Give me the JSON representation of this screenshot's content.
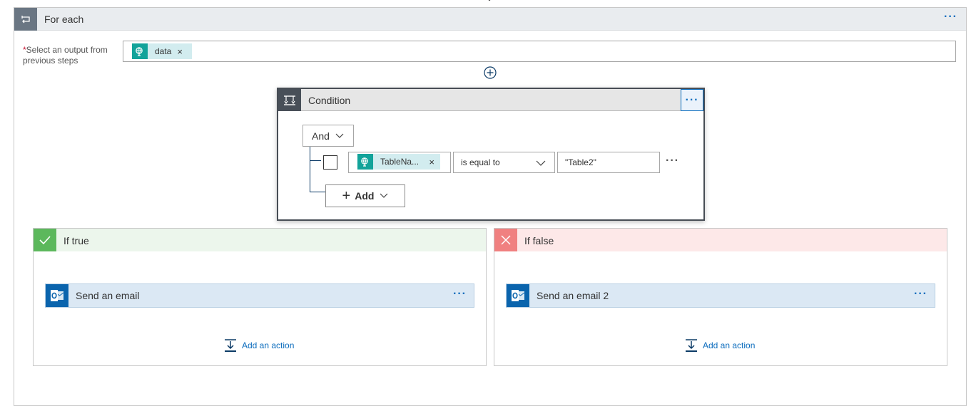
{
  "foreach": {
    "title": "For each",
    "select_label_required_mark": "*",
    "select_label": "Select an output from previous steps",
    "token": {
      "label": "data",
      "remove": "×"
    }
  },
  "condition": {
    "title": "Condition",
    "group_operator": "And",
    "row": {
      "field_token": "TableNa...",
      "field_token_remove": "×",
      "operator": "is equal to",
      "value": "\"Table2\""
    },
    "add_label": "Add"
  },
  "branches": {
    "if_true": {
      "title": "If true",
      "action_title": "Send an email",
      "add_action": "Add an action"
    },
    "if_false": {
      "title": "If false",
      "action_title": "Send an email 2",
      "add_action": "Add an action"
    }
  },
  "more_glyph": "···"
}
